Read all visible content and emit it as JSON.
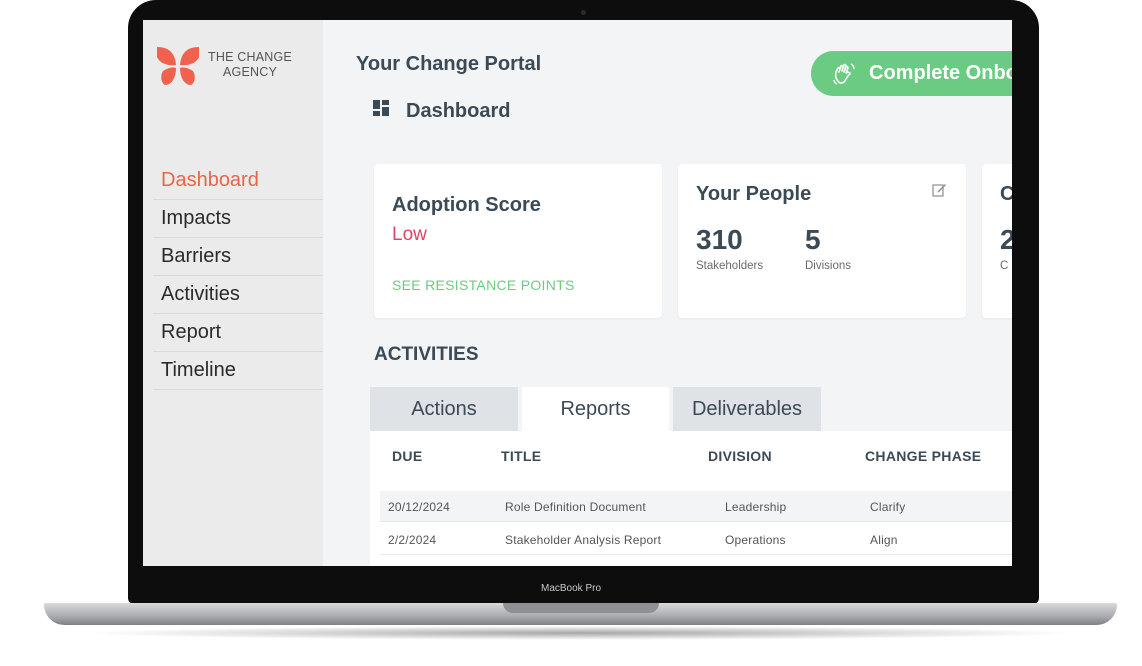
{
  "device": {
    "label": "MacBook Pro"
  },
  "brand": {
    "name_line1": "THE CHANGE",
    "name_line2": "AGENCY",
    "logo_color": "#f0624d"
  },
  "sidebar": {
    "items": [
      {
        "label": "Dashboard",
        "active": true
      },
      {
        "label": "Impacts"
      },
      {
        "label": "Barriers"
      },
      {
        "label": "Activities"
      },
      {
        "label": "Report"
      },
      {
        "label": "Timeline"
      }
    ]
  },
  "header": {
    "portal_title": "Your Change Portal",
    "page_title": "Dashboard",
    "page_icon": "dashboard-grid-icon",
    "cta_label": "Complete Onbo",
    "cta_icon": "waving-hand-icon",
    "cta_color": "#6ccb82"
  },
  "cards": {
    "adoption": {
      "title": "Adoption Score",
      "value": "Low",
      "link": "SEE RESISTANCE POINTS"
    },
    "people": {
      "title": "Your People",
      "icon": "edit-icon",
      "stakeholders_value": "310",
      "stakeholders_label": "Stakeholders",
      "divisions_value": "5",
      "divisions_label": "Divisions"
    },
    "partial": {
      "title": "C",
      "value": "2",
      "label": "C"
    }
  },
  "activities": {
    "heading": "ACTIVITIES",
    "tabs": [
      "Actions",
      "Reports",
      "Deliverables"
    ],
    "active_tab": "Reports",
    "columns": [
      "DUE",
      "TITLE",
      "DIVISION",
      "CHANGE PHASE"
    ],
    "rows": [
      [
        "20/12/2024",
        "Role Definition Document",
        "Leadership",
        "Clarify"
      ],
      [
        "2/2/2024",
        "Stakeholder Analysis Report",
        "Operations",
        "Align"
      ]
    ]
  },
  "colors": {
    "accent": "#e8654a",
    "low_status": "#d9476b",
    "link": "#6ccb82",
    "heading": "#3b4a55"
  }
}
